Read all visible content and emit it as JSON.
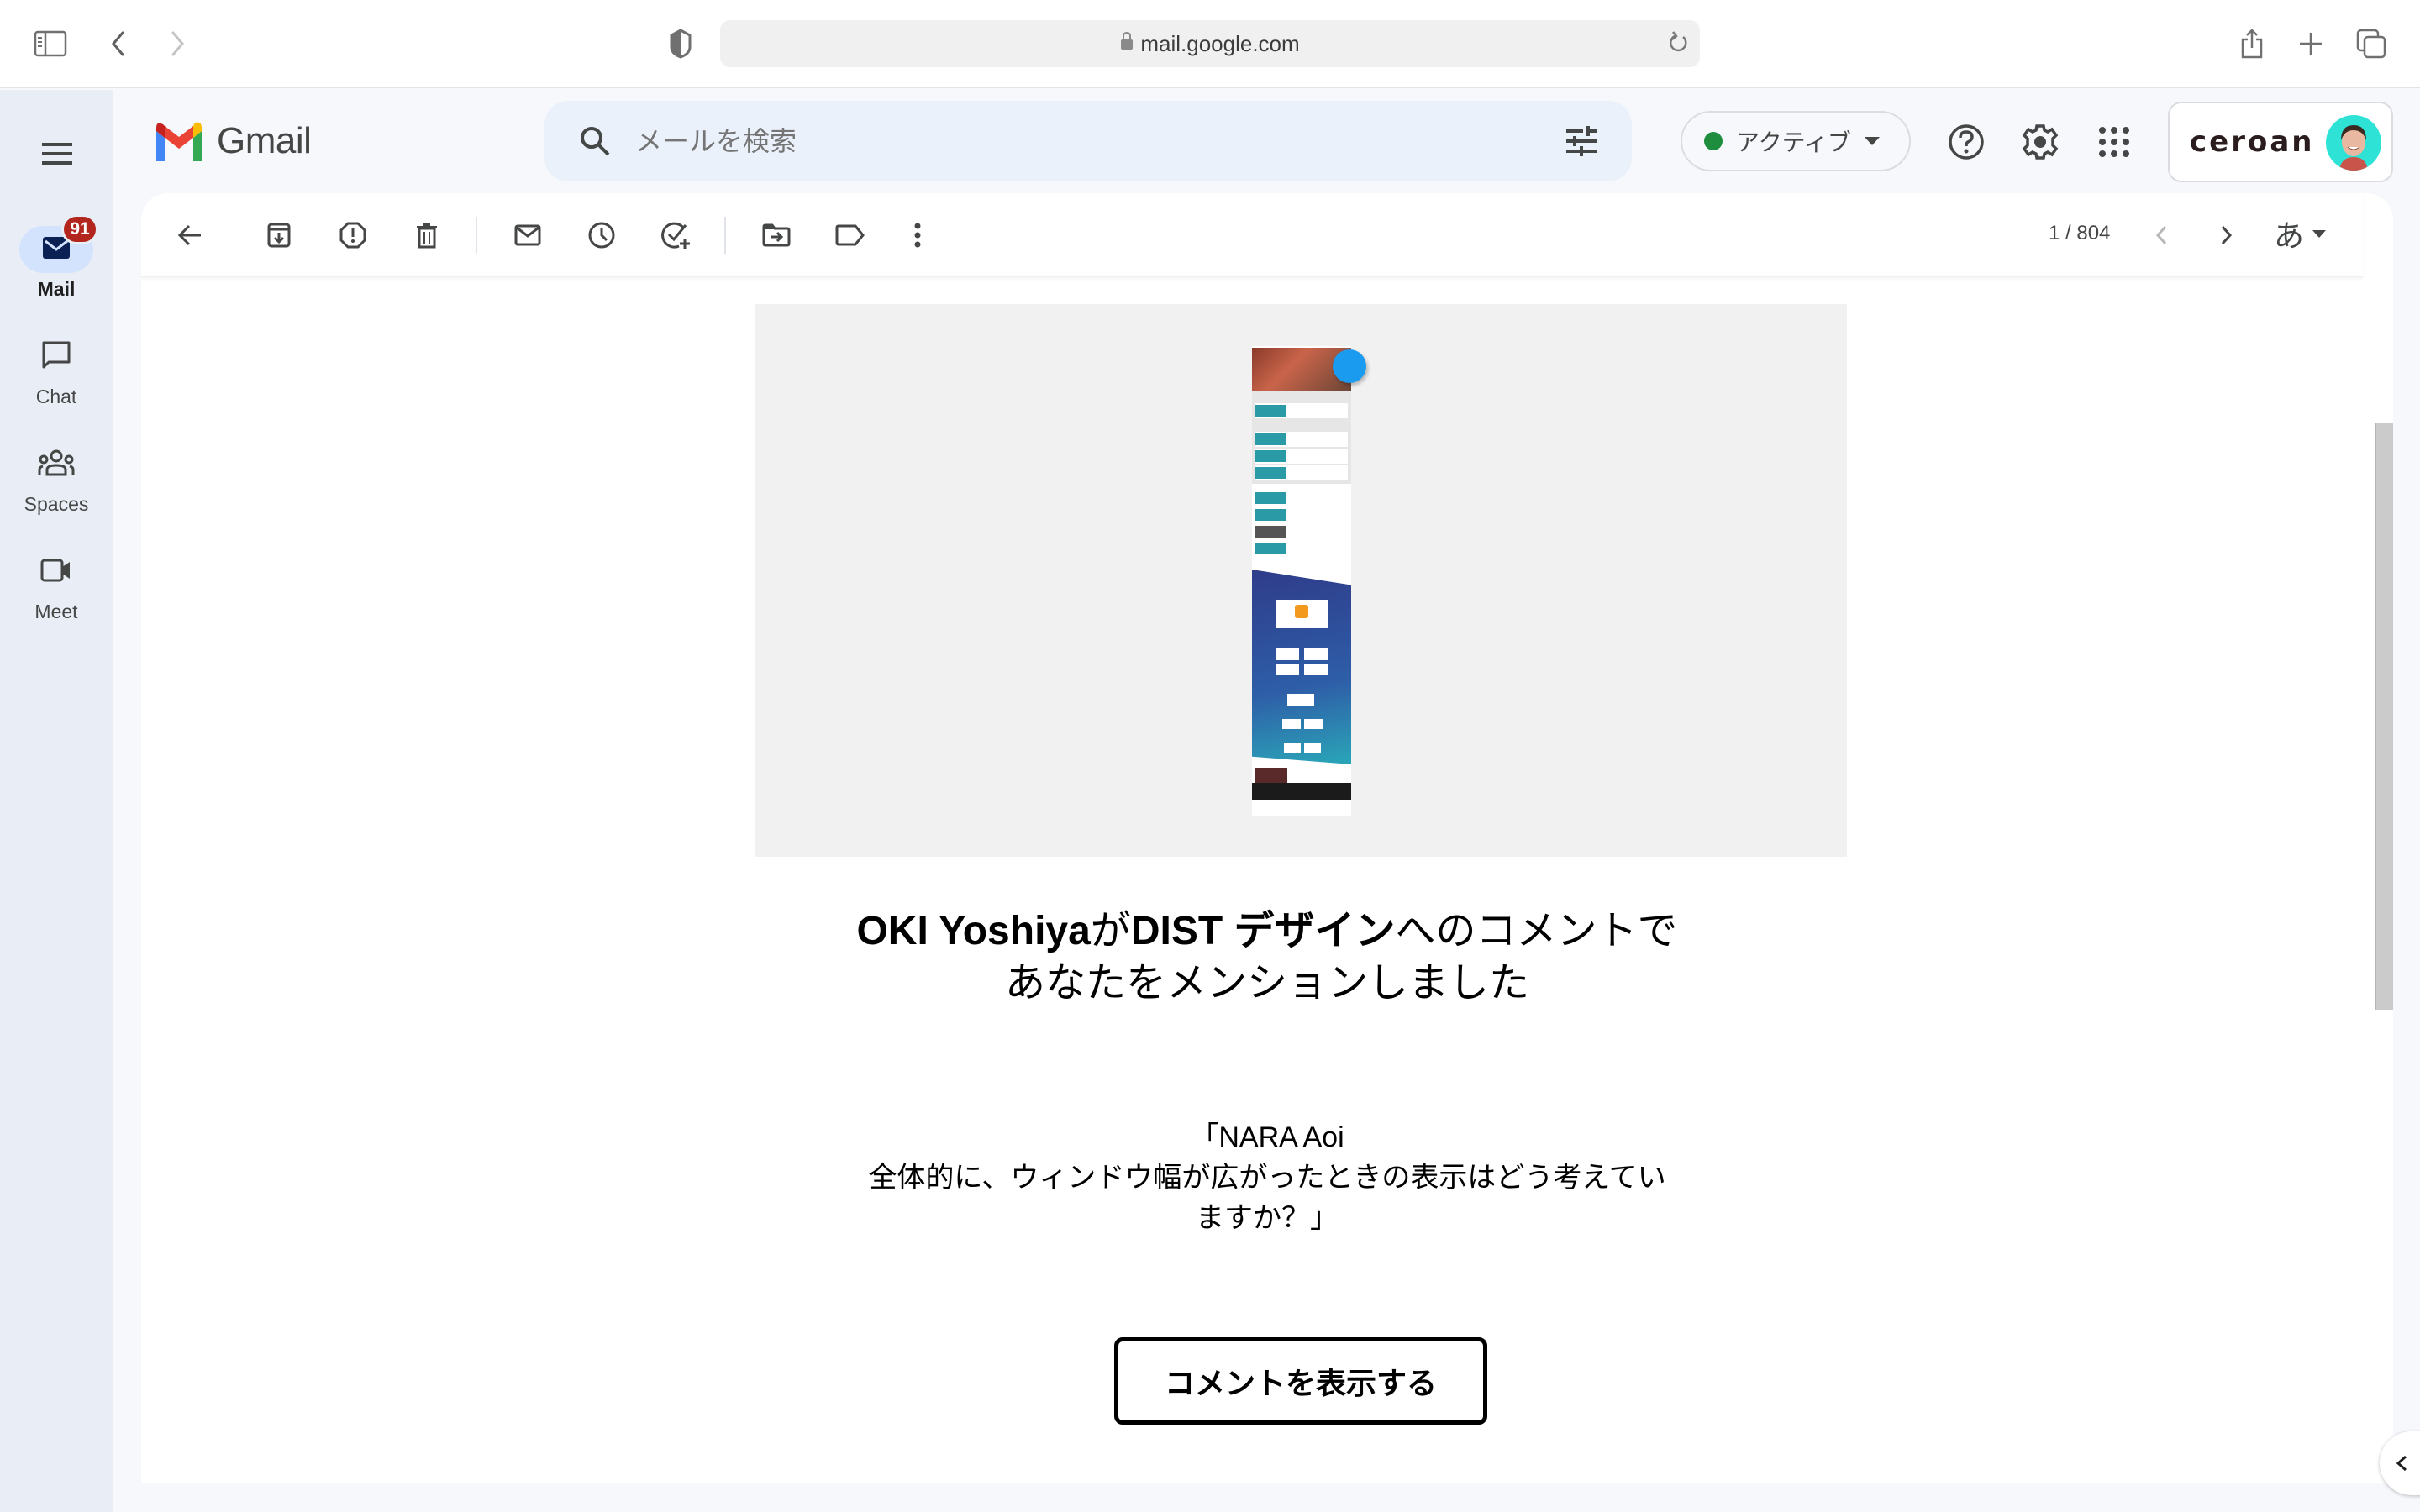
{
  "browser": {
    "url": "mail.google.com",
    "icons": [
      "sidebar-icon",
      "back-icon",
      "forward-icon",
      "privacy-shield-icon",
      "lock-icon",
      "reload-icon",
      "share-icon",
      "new-tab-icon",
      "tab-overview-icon"
    ]
  },
  "rail": {
    "items": [
      {
        "label": "Mail",
        "icon": "mail-icon",
        "badge": "91",
        "active": true
      },
      {
        "label": "Chat",
        "icon": "chat-icon"
      },
      {
        "label": "Spaces",
        "icon": "spaces-icon"
      },
      {
        "label": "Meet",
        "icon": "meet-icon"
      }
    ]
  },
  "header": {
    "app_name": "Gmail",
    "search_placeholder": "メールを検索",
    "status": "アクティブ",
    "status_color": "#1e8e3e",
    "account_name": "ceroan"
  },
  "toolbar": {
    "pager": "1 / 804",
    "input_tool": "あ",
    "actions": [
      "back",
      "archive",
      "report-spam",
      "delete",
      "mark-unread",
      "snooze",
      "add-to-tasks",
      "move-to",
      "labels",
      "more"
    ]
  },
  "email": {
    "title_bold_1": "OKI Yoshiya",
    "title_normal_1": "が",
    "title_bold_2": "DIST デザイン",
    "title_normal_2": "へのコメントで",
    "title_line2": "あなたをメンションしました",
    "quote_line1": "「NARA Aoi",
    "quote_line2": "全体的に、ウィンドウ幅が広がったときの表示はどう考えてい",
    "quote_line3": "ますか？」",
    "cta_label": "コメントを表示する"
  },
  "colors": {
    "rail_bg": "#e9eef6",
    "page_bg": "#f6f8fc",
    "search_bg": "#eaf1fb",
    "badge": "#b3261e",
    "active_pill": "#d3e3fd"
  }
}
